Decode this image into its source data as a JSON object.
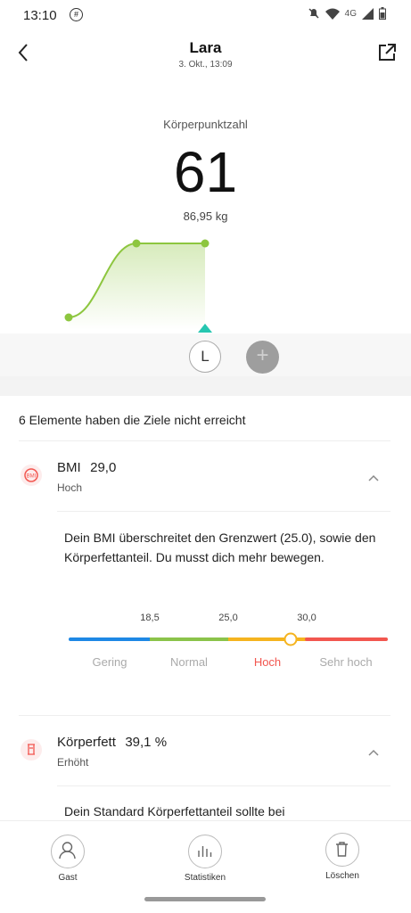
{
  "status_bar": {
    "time": "13:10",
    "network": "4G"
  },
  "header": {
    "title": "Lara",
    "subtitle": "3. Okt., 13:09"
  },
  "score": {
    "label": "Körperpunktzahl",
    "value": "61",
    "weight": "86,95 kg"
  },
  "users": {
    "current_initial": "L",
    "add_symbol": "+"
  },
  "goals_heading": "6 Elemente haben die Ziele nicht erreicht",
  "bmi": {
    "name": "BMI",
    "value": "29,0",
    "status": "Hoch",
    "icon_text": "BMI",
    "description": "Dein BMI überschreitet den Grenzwert (25.0), sowie den Körperfettanteil. Du musst dich mehr bewegen.",
    "thresholds": [
      "18,5",
      "25,0",
      "30,0"
    ],
    "categories": [
      "Gering",
      "Normal",
      "Hoch",
      "Sehr hoch"
    ],
    "active_category": "Hoch",
    "marker_value": 29.0,
    "segment_colors": [
      "#1e88e5",
      "#8bc34a",
      "#f5b41f",
      "#f2564f"
    ]
  },
  "body_fat": {
    "name": "Körperfett",
    "value": "39,1 %",
    "status": "Erhöht",
    "description": "Dein Standard Körperfettanteil sollte bei"
  },
  "bottom_nav": {
    "guest": "Gast",
    "stats": "Statistiken",
    "delete": "Löschen"
  },
  "colors": {
    "accent_green": "#8dc63f",
    "marker_teal": "#26c6b0",
    "alert_red": "#f2564f"
  }
}
